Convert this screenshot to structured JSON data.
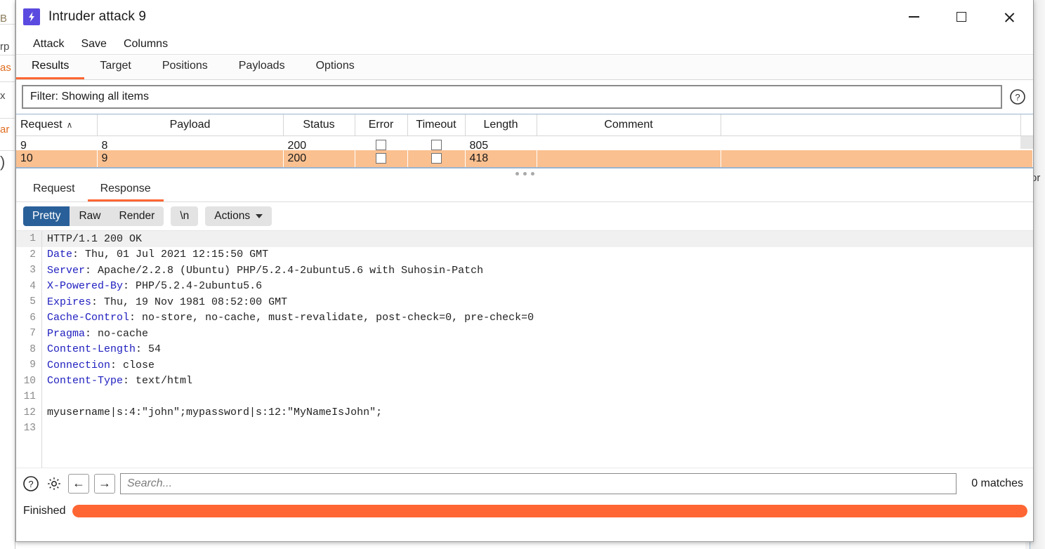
{
  "window": {
    "title": "Intruder attack 9",
    "icon": "lightning-bolt-icon",
    "accent_color": "#ff6633",
    "icon_bg_color": "#5b4ae0",
    "controls": {
      "minimize": "—",
      "maximize": "□",
      "close": "✕"
    }
  },
  "menubar": {
    "items": [
      "Attack",
      "Save",
      "Columns"
    ]
  },
  "main_tabs": {
    "items": [
      "Results",
      "Target",
      "Positions",
      "Payloads",
      "Options"
    ],
    "active": "Results"
  },
  "filter": {
    "text": "Filter: Showing all items",
    "help_icon": "question-circle-icon"
  },
  "results_table": {
    "columns": [
      {
        "label": "Request",
        "sort": "∧"
      },
      {
        "label": "Payload",
        "sort": ""
      },
      {
        "label": "Status",
        "sort": ""
      },
      {
        "label": "Error",
        "sort": ""
      },
      {
        "label": "Timeout",
        "sort": ""
      },
      {
        "label": "Length",
        "sort": ""
      },
      {
        "label": "Comment",
        "sort": ""
      }
    ],
    "rows": [
      {
        "request": "9",
        "payload": "8",
        "status": "200",
        "error": "",
        "timeout": "",
        "length": "805",
        "comment": "",
        "selected": false
      },
      {
        "request": "10",
        "payload": "9",
        "status": "200",
        "error": "",
        "timeout": "",
        "length": "418",
        "comment": "",
        "selected": true
      }
    ],
    "selected_row_color": "#fac090"
  },
  "message_tabs": {
    "items": [
      "Request",
      "Response"
    ],
    "active": "Response"
  },
  "view_toolbar": {
    "segments": [
      "Pretty",
      "Raw",
      "Render"
    ],
    "active_segment": "Pretty",
    "newline_button": "\\n",
    "actions_button": "Actions",
    "actions_chevron": "chevron-down-icon"
  },
  "response": {
    "lines": [
      {
        "n": "1",
        "key": "",
        "value": "HTTP/1.1 200 OK",
        "highlight": true
      },
      {
        "n": "2",
        "key": "Date",
        "value": " Thu, 01 Jul 2021 12:15:50 GMT",
        "highlight": false
      },
      {
        "n": "3",
        "key": "Server",
        "value": " Apache/2.2.8 (Ubuntu) PHP/5.2.4-2ubuntu5.6 with Suhosin-Patch",
        "highlight": false
      },
      {
        "n": "4",
        "key": "X-Powered-By",
        "value": " PHP/5.2.4-2ubuntu5.6",
        "highlight": false
      },
      {
        "n": "5",
        "key": "Expires",
        "value": " Thu, 19 Nov 1981 08:52:00 GMT",
        "highlight": false
      },
      {
        "n": "6",
        "key": "Cache-Control",
        "value": " no-store, no-cache, must-revalidate, post-check=0, pre-check=0",
        "highlight": false
      },
      {
        "n": "7",
        "key": "Pragma",
        "value": " no-cache",
        "highlight": false
      },
      {
        "n": "8",
        "key": "Content-Length",
        "value": " 54",
        "highlight": false
      },
      {
        "n": "9",
        "key": "Connection",
        "value": " close",
        "highlight": false
      },
      {
        "n": "10",
        "key": "Content-Type",
        "value": " text/html",
        "highlight": false
      },
      {
        "n": "11",
        "key": "",
        "value": "",
        "highlight": false
      },
      {
        "n": "12",
        "key": "",
        "value": "myusername|s:4:\"john\";mypassword|s:12:\"MyNameIsJohn\";",
        "highlight": false
      },
      {
        "n": "13",
        "key": "",
        "value": "",
        "highlight": false
      }
    ]
  },
  "search_bar": {
    "help_icon": "question-circle-icon",
    "settings_icon": "gear-icon",
    "prev_icon": "arrow-left-icon",
    "next_icon": "arrow-right-icon",
    "placeholder": "Search...",
    "value": "",
    "matches": "0 matches"
  },
  "status": {
    "label": "Finished",
    "progress_percent": 100,
    "progress_color": "#ff6633"
  },
  "background": {
    "left_fragments": [
      "B",
      "rp",
      "as",
      "x",
      "ar",
      ")"
    ],
    "right_fragment": "or"
  }
}
